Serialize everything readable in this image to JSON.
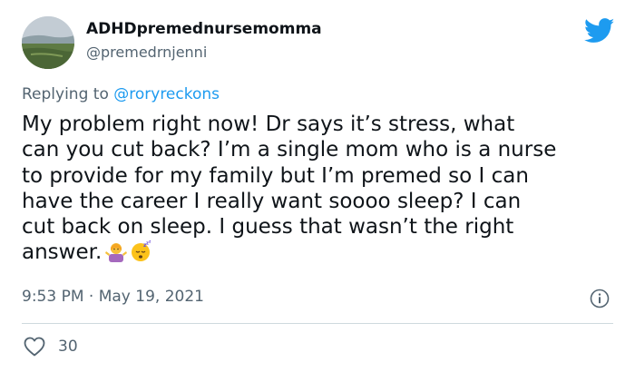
{
  "tweet": {
    "display_name": "ADHDpremednursemomma",
    "handle": "@premedrnjenni",
    "replying_prefix": "Replying to",
    "replying_to": "@roryreckons",
    "text": "My problem right now! Dr says it’s stress, what\ncan you cut back? I’m a single mom who is a nurse\nto provide for my family but I’m premed so I can\nhave the career I really want soooo sleep? I can\ncut back on sleep. I guess that wasn’t the right\nanswer.",
    "emojis": [
      "person-shrugging-emoji",
      "sleeping-face-emoji"
    ],
    "timestamp": "9:53 PM · May 19, 2021",
    "like_count": "30"
  },
  "icons": {
    "brand": "twitter-bird-icon",
    "info": "info-icon",
    "like": "heart-icon"
  },
  "colors": {
    "brand_blue": "#1d9bf0",
    "secondary_text": "#536471",
    "divider": "#cfd9de"
  }
}
